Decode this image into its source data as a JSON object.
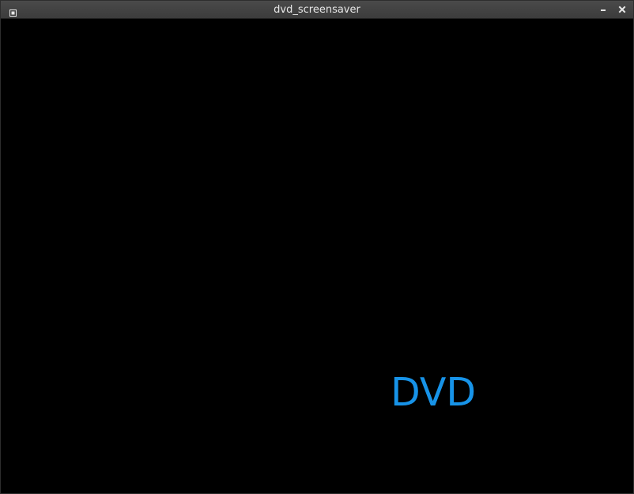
{
  "window": {
    "title": "dvd_screensaver",
    "icons": {
      "menu": "window-menu-icon",
      "minimize": "minimize-icon",
      "close": "close-icon"
    }
  },
  "canvas": {
    "logo_text": "DVD",
    "logo_color": "#1793e8",
    "background_color": "#000000"
  }
}
